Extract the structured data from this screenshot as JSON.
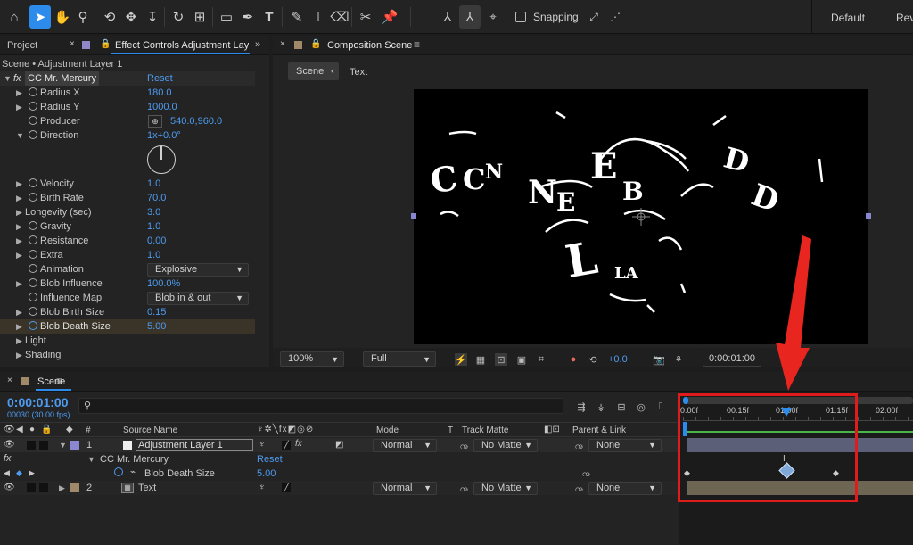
{
  "toolbar": {
    "snapping_label": "Snapping",
    "workspace_default": "Default",
    "workspace_review": "Review"
  },
  "project_panel": {
    "tab_label": "Project"
  },
  "effect_controls": {
    "tab_label": "Effect Controls Adjustment Layer",
    "breadcrumb": "Scene • Adjustment Layer 1",
    "effect_name": "CC Mr. Mercury",
    "reset_label": "Reset",
    "properties": [
      {
        "name": "Radius X",
        "value": "180.0"
      },
      {
        "name": "Radius Y",
        "value": "1000.0"
      },
      {
        "name": "Producer",
        "value": "540.0,960.0"
      },
      {
        "name": "Direction",
        "value": "1x+0.0°"
      },
      {
        "name": "Velocity",
        "value": "1.0"
      },
      {
        "name": "Birth Rate",
        "value": "70.0"
      },
      {
        "name": "Longevity (sec)",
        "value": "3.0"
      },
      {
        "name": "Gravity",
        "value": "1.0"
      },
      {
        "name": "Resistance",
        "value": "0.00"
      },
      {
        "name": "Extra",
        "value": "1.0"
      },
      {
        "name": "Animation",
        "value": "Explosive"
      },
      {
        "name": "Blob Influence",
        "value": "100.0%"
      },
      {
        "name": "Influence Map",
        "value": "Blob in & out"
      },
      {
        "name": "Blob Birth Size",
        "value": "0.15"
      },
      {
        "name": "Blob Death Size",
        "value": "5.00"
      },
      {
        "name": "Light",
        "value": ""
      },
      {
        "name": "Shading",
        "value": ""
      }
    ]
  },
  "composition": {
    "tab_label": "Composition Scene",
    "nav_scene": "Scene",
    "nav_text": "Text",
    "zoom": "100%",
    "resolution": "Full",
    "exposure": "+0.0",
    "timecode": "0:00:01:00"
  },
  "timeline": {
    "tab_label": "Scene",
    "current_time": "0:00:01:00",
    "frame_info": "00030 (30.00 fps)",
    "headers": {
      "number": "#",
      "source_name": "Source Name",
      "mode": "Mode",
      "t": "T",
      "track_matte": "Track Matte",
      "parent_link": "Parent & Link"
    },
    "ruler_ticks": [
      "0:00f",
      "00:15f",
      "01:00f",
      "01:15f",
      "02:00f"
    ],
    "layers": [
      {
        "index": "1",
        "name": "Adjustment Layer 1",
        "mode": "Normal",
        "matte": "No Matte",
        "parent": "None"
      },
      {
        "index": "2",
        "name": "Text",
        "mode": "Normal",
        "matte": "No Matte",
        "parent": "None"
      }
    ],
    "effect_row": {
      "name": "CC Mr. Mercury",
      "reset": "Reset"
    },
    "property_row": {
      "name": "Blob Death Size",
      "value": "5.00"
    }
  },
  "colors": {
    "accent": "#2d8ceb",
    "highlight_box": "#e01b1b",
    "arrow": "#e8261f",
    "adjustment_bar": "#5c5f78",
    "text_bar": "#6e6553"
  }
}
